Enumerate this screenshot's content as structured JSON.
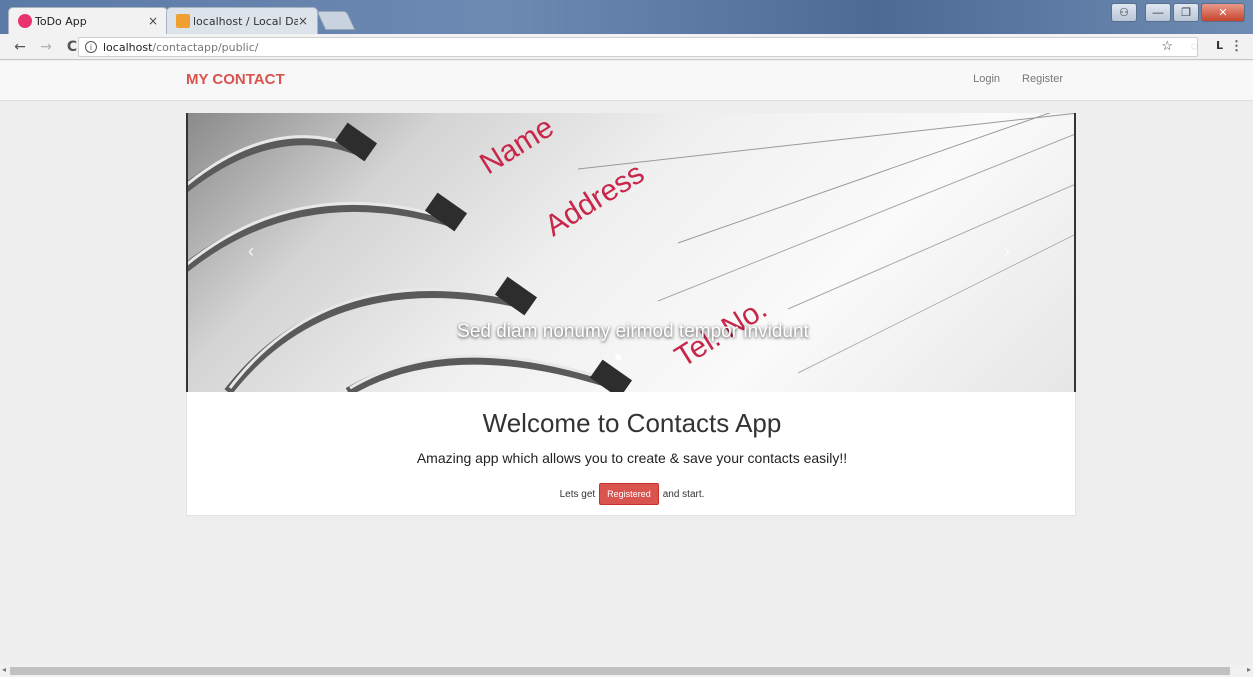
{
  "browser": {
    "tabs": [
      {
        "title": "ToDo App",
        "active": true,
        "favicon_color": "#e8336d"
      },
      {
        "title": "localhost / Local Databa:",
        "active": false,
        "favicon_color": "#f0a030"
      }
    ],
    "url_host": "localhost",
    "url_path": "/contactapp/public/",
    "profile_letter": "L"
  },
  "nav": {
    "brand": "MY CONTACT",
    "login": "Login",
    "register": "Register",
    "brand_color": "#d9534f"
  },
  "carousel": {
    "words": [
      "Name",
      "Address",
      "Tel. No."
    ],
    "caption": "Sed diam nonumy eirmod tempor invidunt",
    "prev": "‹",
    "next": "›"
  },
  "welcome": {
    "title": "Welcome to Contacts App",
    "subtitle": "Amazing app which allows you to create & save your contacts easily!!",
    "cta_prefix": "Lets get",
    "cta_button": "Registered",
    "cta_suffix": "and start."
  },
  "icons": {
    "back": "←",
    "forward": "→",
    "reload": "C",
    "info": "i",
    "star": "☆",
    "menu": "⋮",
    "tab_close": "×"
  }
}
